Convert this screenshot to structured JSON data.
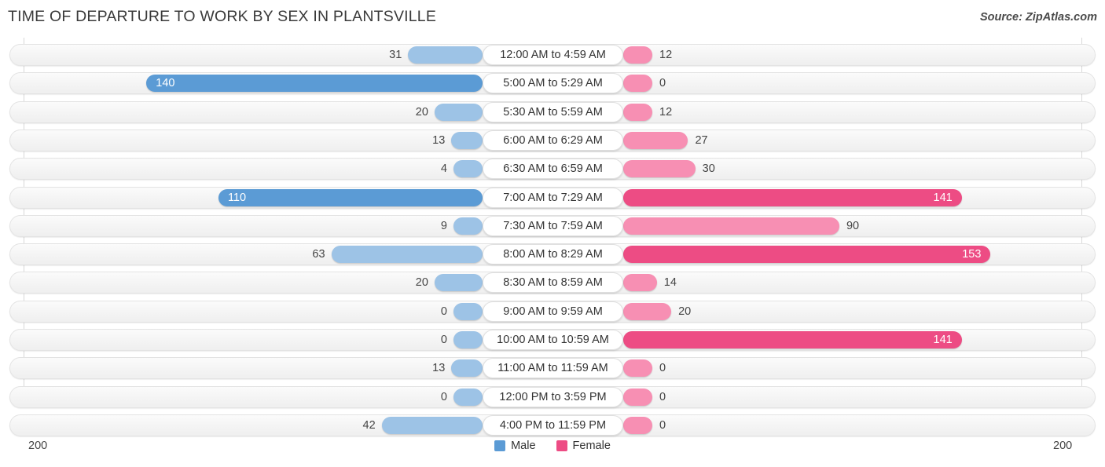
{
  "header": {
    "title": "TIME OF DEPARTURE TO WORK BY SEX IN PLANTSVILLE",
    "source": "Source: ZipAtlas.com"
  },
  "axis": {
    "left_label": "200",
    "right_label": "200",
    "max": 200
  },
  "legend": {
    "items": [
      {
        "label": "Male",
        "color": "#5b9bd5"
      },
      {
        "label": "Female",
        "color": "#ed4c84"
      }
    ]
  },
  "colors": {
    "male_light": "#9dc3e6",
    "male_dark": "#5b9bd5",
    "female_light": "#f78fb3",
    "female_dark": "#ed4c84",
    "track": "#f4f4f4",
    "gridline": "#d8d8d8"
  },
  "chart_data": {
    "type": "bar",
    "title": "TIME OF DEPARTURE TO WORK BY SEX IN PLANTSVILLE",
    "subtitle": "",
    "xlabel": "",
    "ylabel": "",
    "orientation": "horizontal-diverging",
    "xlim": [
      200,
      200
    ],
    "grid": true,
    "legend_position": "bottom-center",
    "categories": [
      "12:00 AM to 4:59 AM",
      "5:00 AM to 5:29 AM",
      "5:30 AM to 5:59 AM",
      "6:00 AM to 6:29 AM",
      "6:30 AM to 6:59 AM",
      "7:00 AM to 7:29 AM",
      "7:30 AM to 7:59 AM",
      "8:00 AM to 8:29 AM",
      "8:30 AM to 8:59 AM",
      "9:00 AM to 9:59 AM",
      "10:00 AM to 10:59 AM",
      "11:00 AM to 11:59 AM",
      "12:00 PM to 3:59 PM",
      "4:00 PM to 11:59 PM"
    ],
    "series": [
      {
        "name": "Male",
        "values": [
          31,
          140,
          20,
          13,
          4,
          110,
          9,
          63,
          20,
          0,
          0,
          13,
          0,
          42
        ]
      },
      {
        "name": "Female",
        "values": [
          12,
          0,
          12,
          27,
          30,
          141,
          90,
          153,
          14,
          20,
          141,
          0,
          0,
          0
        ]
      }
    ]
  },
  "rows": [
    {
      "category": "12:00 AM to 4:59 AM",
      "male": 31,
      "female": 12,
      "male_label": "31",
      "female_label": "12"
    },
    {
      "category": "5:00 AM to 5:29 AM",
      "male": 140,
      "female": 0,
      "male_label": "140",
      "female_label": "0"
    },
    {
      "category": "5:30 AM to 5:59 AM",
      "male": 20,
      "female": 12,
      "male_label": "20",
      "female_label": "12"
    },
    {
      "category": "6:00 AM to 6:29 AM",
      "male": 13,
      "female": 27,
      "male_label": "13",
      "female_label": "27"
    },
    {
      "category": "6:30 AM to 6:59 AM",
      "male": 4,
      "female": 30,
      "male_label": "4",
      "female_label": "30"
    },
    {
      "category": "7:00 AM to 7:29 AM",
      "male": 110,
      "female": 141,
      "male_label": "110",
      "female_label": "141"
    },
    {
      "category": "7:30 AM to 7:59 AM",
      "male": 9,
      "female": 90,
      "male_label": "9",
      "female_label": "90"
    },
    {
      "category": "8:00 AM to 8:29 AM",
      "male": 63,
      "female": 153,
      "male_label": "63",
      "female_label": "153"
    },
    {
      "category": "8:30 AM to 8:59 AM",
      "male": 20,
      "female": 14,
      "male_label": "20",
      "female_label": "14"
    },
    {
      "category": "9:00 AM to 9:59 AM",
      "male": 0,
      "female": 20,
      "male_label": "0",
      "female_label": "20"
    },
    {
      "category": "10:00 AM to 10:59 AM",
      "male": 0,
      "female": 141,
      "male_label": "0",
      "female_label": "141"
    },
    {
      "category": "11:00 AM to 11:59 AM",
      "male": 13,
      "female": 0,
      "male_label": "13",
      "female_label": "0"
    },
    {
      "category": "12:00 PM to 3:59 PM",
      "male": 0,
      "female": 0,
      "male_label": "0",
      "female_label": "0"
    },
    {
      "category": "4:00 PM to 11:59 PM",
      "male": 42,
      "female": 0,
      "male_label": "42",
      "female_label": "0"
    }
  ]
}
